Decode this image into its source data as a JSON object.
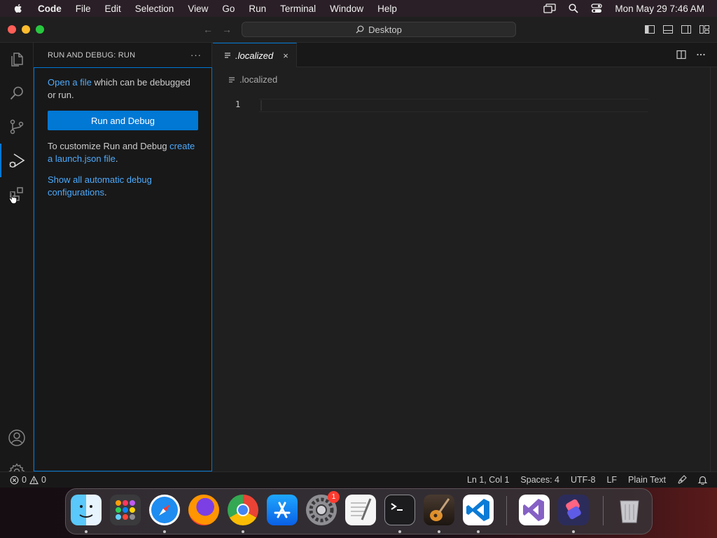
{
  "menubar": {
    "app": "Code",
    "items": [
      "File",
      "Edit",
      "Selection",
      "View",
      "Go",
      "Run",
      "Terminal",
      "Window",
      "Help"
    ],
    "clock": "Mon May 29  7:46 AM"
  },
  "titlebar": {
    "search": "Desktop"
  },
  "sidebar": {
    "title": "RUN AND DEBUG: RUN",
    "more": "···",
    "open_file_link": "Open a file",
    "open_file_rest": " which can be debugged or run.",
    "run_button": "Run and Debug",
    "customize_text": "To customize Run and Debug ",
    "launch_link": "create a launch.json file",
    "period1": ".",
    "show_link": "Show all automatic debug configurations",
    "period2": "."
  },
  "editor": {
    "tab_label": ".localized",
    "tab_close": "×",
    "breadcrumb": ".localized",
    "line_number": "1"
  },
  "statusbar": {
    "errors": "0",
    "warnings": "0",
    "position": "Ln 1, Col 1",
    "spaces": "Spaces: 4",
    "encoding": "UTF-8",
    "eol": "LF",
    "language": "Plain Text"
  },
  "dock": {
    "settings_badge": "1",
    "apps": [
      "finder-icon",
      "launchpad-icon",
      "safari-icon",
      "firefox-icon",
      "chrome-icon",
      "app-store-icon",
      "system-settings-icon",
      "textedit-icon",
      "terminal-icon",
      "garageband-icon",
      "vscode-icon",
      "visual-studio-icon",
      "shortcuts-icon",
      "trash-icon"
    ]
  },
  "colors": {
    "accent": "#0078d4",
    "link": "#4daafc",
    "background": "#1f1f1f"
  }
}
